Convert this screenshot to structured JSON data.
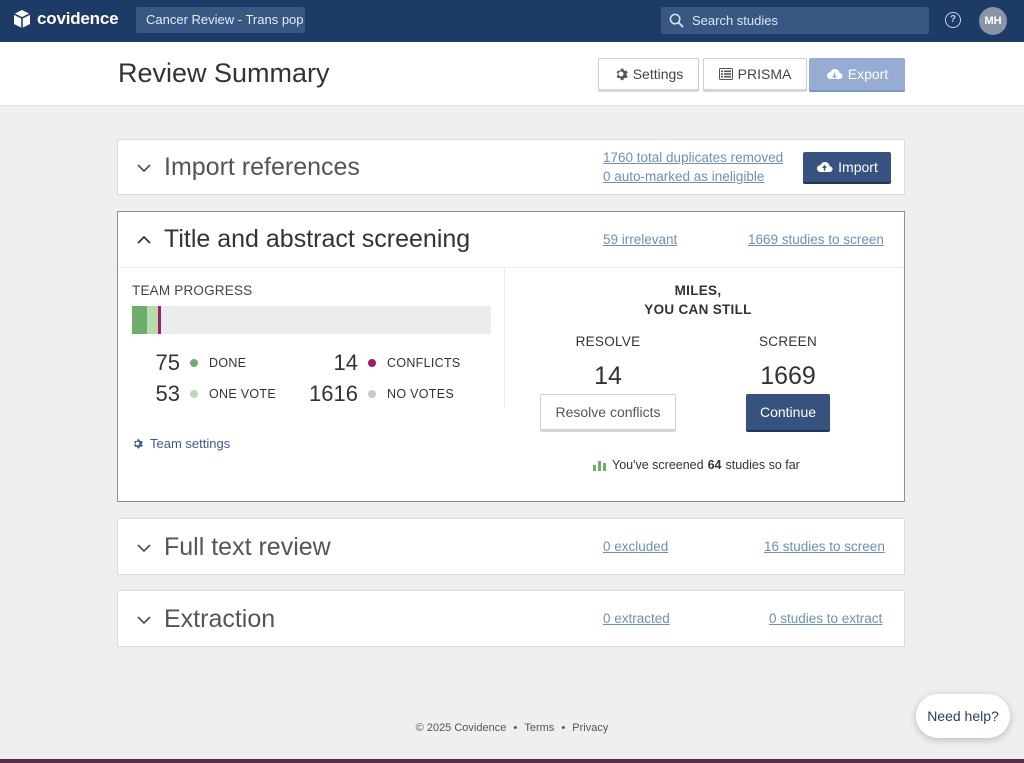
{
  "nav": {
    "brand": "covidence",
    "review_name": "Cancer Review - Trans pop",
    "search_placeholder": "Search studies",
    "help": "?",
    "avatar_initials": "MH"
  },
  "header": {
    "title": "Review Summary",
    "settings_label": "Settings",
    "prisma_label": "PRISMA",
    "export_label": "Export"
  },
  "import_references": {
    "title": "Import references",
    "duplicates_link": "1760 total duplicates removed",
    "ineligible_link": "0 auto-marked as ineligible",
    "import_label": "Import"
  },
  "screening": {
    "title": "Title and abstract screening",
    "irrelevant_link": "59 irrelevant",
    "to_screen_link": "1669 studies to screen",
    "team_progress_label": "TEAM PROGRESS",
    "progress": {
      "total": 1758,
      "done": 75,
      "one_vote": 53,
      "conflicts": 14,
      "no_votes": 1616
    },
    "stats": {
      "done": {
        "num": "75",
        "label": "DONE"
      },
      "conflicts": {
        "num": "14",
        "label": "CONFLICTS"
      },
      "one_vote": {
        "num": "53",
        "label": "ONE VOTE"
      },
      "no_votes": {
        "num": "1616",
        "label": "NO VOTES"
      }
    },
    "team_settings_label": "Team settings",
    "greeting_line1": "MILES,",
    "greeting_line2": "YOU CAN STILL",
    "resolve_label": "RESOLVE",
    "resolve_count": "14",
    "resolve_button": "Resolve conflicts",
    "screen_label": "SCREEN",
    "screen_count": "1669",
    "continue_button": "Continue",
    "screened_prefix": "You've screened",
    "screened_count": "64",
    "screened_suffix": "studies so far"
  },
  "full_text": {
    "title": "Full text review",
    "excluded_link": "0 excluded",
    "to_screen_link": "16 studies to screen"
  },
  "extraction": {
    "title": "Extraction",
    "extracted_link": "0 extracted",
    "to_extract_link": "0 studies to extract"
  },
  "footer": {
    "copyright": "© 2025 Covidence",
    "sep": "•",
    "terms": "Terms",
    "privacy": "Privacy"
  },
  "need_help": "Need help?",
  "colors": {
    "navbar": "#1e3a66",
    "primary_button": "#37527f",
    "export_button": "#97acd2",
    "link": "#6f8fb3",
    "done": "#6fae6a",
    "one_vote": "#b6dcae",
    "conflicts": "#9c1f68",
    "no_votes": "#c9c9c9"
  },
  "icons": {
    "logo": "covidence-box-icon",
    "search": "search-icon",
    "settings": "gear-icon",
    "prisma": "list-icon",
    "export": "cloud-download-icon",
    "import": "cloud-upload-icon",
    "bar_chart": "bar-chart-icon"
  }
}
